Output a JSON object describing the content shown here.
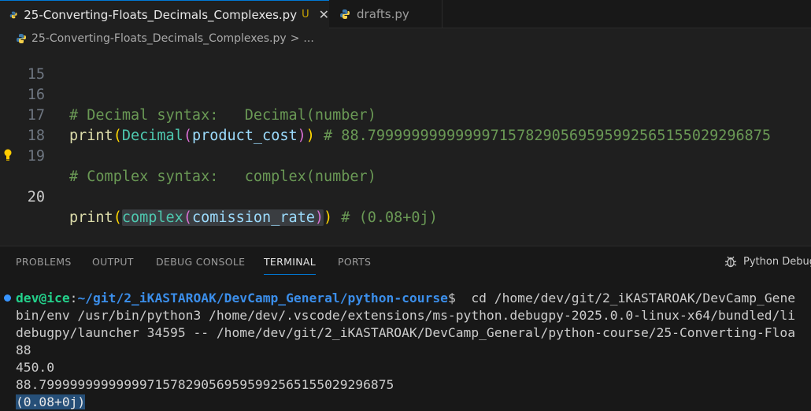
{
  "tabs": [
    {
      "label": "25-Converting-Floats_Decimals_Complexes.py",
      "modified": "U",
      "close": "✕"
    },
    {
      "label": "drafts.py"
    }
  ],
  "breadcrumb": {
    "file": "25-Converting-Floats_Decimals_Complexes.py",
    "sep": ">",
    "more": "..."
  },
  "editor": {
    "lines": [
      {
        "n": "15"
      },
      {
        "n": "16",
        "comment": "# Decimal syntax:   Decimal(number)"
      },
      {
        "n": "17",
        "print": "print",
        "p1": "(",
        "cls": "Decimal",
        "p2": "(",
        "arg": "product_cost",
        "p3": ")",
        "p4": ")",
        "comment": " # 88.7999999999999971578290569595992565155029296875"
      },
      {
        "n": "18"
      },
      {
        "n": "19",
        "comment": "# Complex syntax:   complex(number)"
      },
      {
        "n": "20",
        "print": "print",
        "p1": "(",
        "cls": "complex",
        "p2": "(",
        "arg": "comission_rate",
        "p3": ")",
        "p4": ")",
        "comment": " # (0.08+0j)"
      }
    ],
    "colors": {
      "comment": "#6a9955",
      "function": "#dcdcaa",
      "class": "#4ec9b0",
      "variable": "#9cdcfe"
    }
  },
  "panel": {
    "tabs": [
      "PROBLEMS",
      "OUTPUT",
      "DEBUG CONSOLE",
      "TERMINAL",
      "PORTS"
    ],
    "active_tab": "TERMINAL",
    "debug_label": "Python Debug"
  },
  "terminal": {
    "user": "dev@ice",
    "colon": ":",
    "path": "~/git/2_iKASTAROAK/DevCamp_General/python-course",
    "prompt": "$",
    "cmd": "  cd /home/dev/git/2_iKASTAROAK/DevCamp_Gene",
    "lines": [
      "bin/env /usr/bin/python3 /home/dev/.vscode/extensions/ms-python.debugpy-2025.0.0-linux-x64/bundled/li",
      "debugpy/launcher 34595 -- /home/dev/git/2_iKASTAROAK/DevCamp_General/python-course/25-Converting-Floa",
      "88",
      "450.0",
      "88.7999999999999971578290569595992565155029296875"
    ],
    "selected_line": "(0.08+0j)"
  }
}
